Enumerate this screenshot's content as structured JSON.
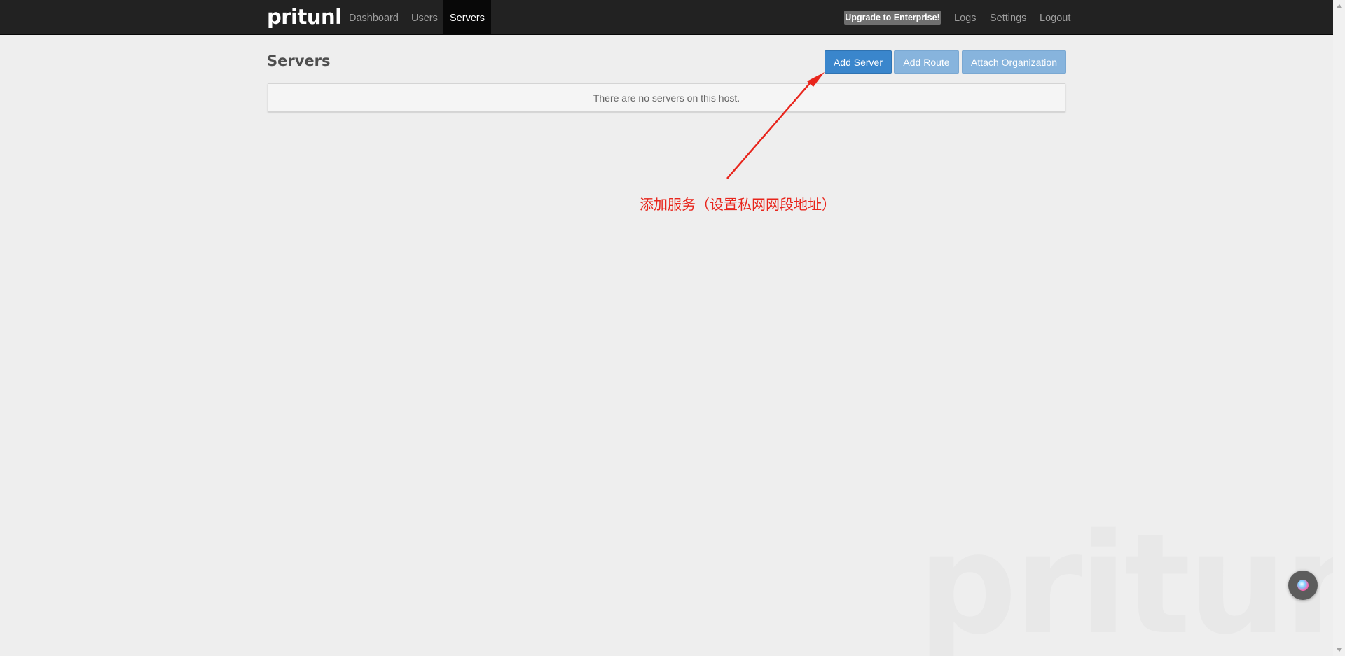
{
  "navbar": {
    "brand": "pritunl",
    "links": [
      "Dashboard",
      "Users",
      "Servers"
    ],
    "active": "Servers",
    "upgrade_label": "Upgrade to Enterprise!",
    "right_links": [
      "Logs",
      "Settings",
      "Logout"
    ]
  },
  "header": {
    "title": "Servers",
    "buttons": [
      "Add Server",
      "Add Route",
      "Attach Organization"
    ]
  },
  "main": {
    "empty_message": "There are no servers on this host."
  },
  "annotation": {
    "text": "添加服务（设置私网网段地址）",
    "color": "#e8251c"
  },
  "watermark": "pritunl",
  "icons": {
    "float_button": "assistant-orb-icon",
    "scroll_up": "chevron-up-icon",
    "scroll_down": "chevron-down-icon"
  }
}
